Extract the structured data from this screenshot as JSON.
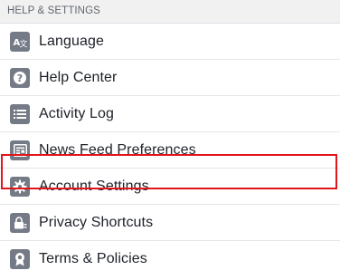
{
  "section": {
    "title": "HELP & SETTINGS"
  },
  "items": [
    {
      "label": "Language",
      "icon": "language-icon"
    },
    {
      "label": "Help Center",
      "icon": "help-question-icon"
    },
    {
      "label": "Activity Log",
      "icon": "list-icon"
    },
    {
      "label": "News Feed Preferences",
      "icon": "news-feed-icon",
      "highlighted": true
    },
    {
      "label": "Account Settings",
      "icon": "gear-icon"
    },
    {
      "label": "Privacy Shortcuts",
      "icon": "privacy-lock-icon"
    },
    {
      "label": "Terms & Policies",
      "icon": "terms-badge-icon"
    }
  ],
  "colors": {
    "icon_bg": "#747a86",
    "highlight": "#e0161d",
    "header_bg": "#f1f1f1",
    "text": "#1d2129"
  }
}
